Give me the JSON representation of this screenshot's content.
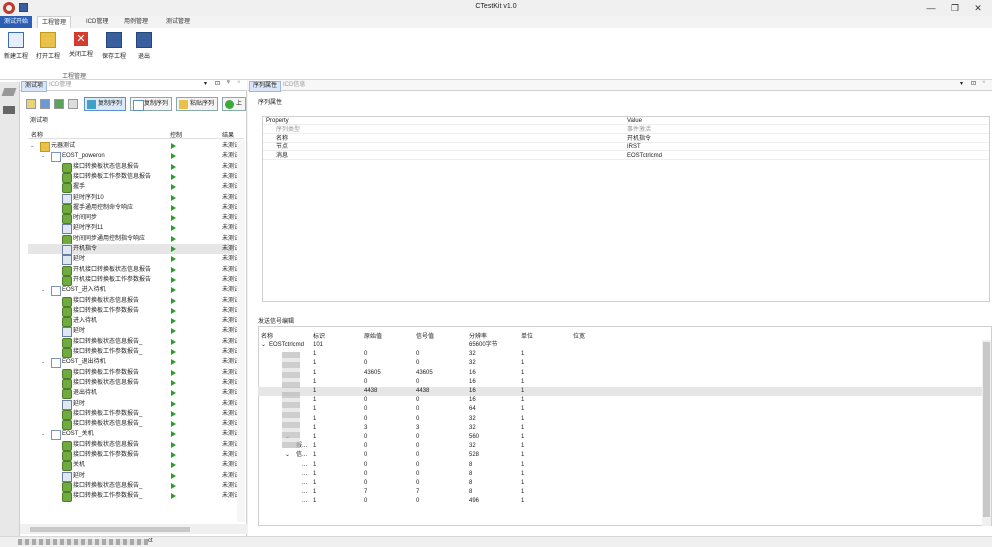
{
  "app": {
    "title": "CTestKit v1.0",
    "window_controls": [
      "—",
      "❐",
      "✕"
    ]
  },
  "ribbon": {
    "tabs": [
      "测试开始",
      "工程管理",
      "ICD管理",
      "用例管理",
      "测试管理"
    ],
    "buttons": [
      "新建工程",
      "打开工程",
      "关闭工程",
      "保存工程",
      "退出"
    ],
    "group_label": "工程管理"
  },
  "left_panel": {
    "tabs": [
      "测试项",
      "ICD管理"
    ],
    "toolbar_buttons": [
      "复制序列",
      "复制序列",
      "粘贴序列",
      "上"
    ],
    "caption": "测试项",
    "columns": [
      "名称",
      "控制",
      "结果"
    ],
    "tree": [
      {
        "label": "元器测试",
        "result": "未测试",
        "indent": 0,
        "type": "folder",
        "arrow": "⌄"
      },
      {
        "label": "EOST_poweron",
        "result": "未测试",
        "indent": 1,
        "type": "doc",
        "arrow": "⌄"
      },
      {
        "label": "接口转换板状态信息报告",
        "result": "未测试",
        "indent": 2,
        "type": "gear"
      },
      {
        "label": "接口转换板工作参数信息报告",
        "result": "未测试",
        "indent": 2,
        "type": "gear"
      },
      {
        "label": "握手",
        "result": "未测试",
        "indent": 2,
        "type": "gear"
      },
      {
        "label": "延时序列10",
        "result": "未测试",
        "indent": 2,
        "type": "wait"
      },
      {
        "label": "握手通用控制命令响应",
        "result": "未测试",
        "indent": 2,
        "type": "gear"
      },
      {
        "label": "时间同步",
        "result": "未测试",
        "indent": 2,
        "type": "gear"
      },
      {
        "label": "延时序列11",
        "result": "未测试",
        "indent": 2,
        "type": "wait"
      },
      {
        "label": "时间同步通用控制指令响应",
        "result": "未测试",
        "indent": 2,
        "type": "gear"
      },
      {
        "label": "开机指令",
        "result": "未测试",
        "indent": 2,
        "type": "wait",
        "selected": true
      },
      {
        "label": "延时",
        "result": "未测试",
        "indent": 2,
        "type": "wait"
      },
      {
        "label": "开机接口转换板状态信息报告",
        "result": "未测试",
        "indent": 2,
        "type": "gear"
      },
      {
        "label": "开机接口转换板工作参数报告",
        "result": "未测试",
        "indent": 2,
        "type": "gear"
      },
      {
        "label": "EOST_进入待机",
        "result": "未测试",
        "indent": 1,
        "type": "doc",
        "arrow": "⌄"
      },
      {
        "label": "接口转换板状态信息报告",
        "result": "未测试",
        "indent": 2,
        "type": "gear"
      },
      {
        "label": "接口转换板工作参数报告",
        "result": "未测试",
        "indent": 2,
        "type": "gear"
      },
      {
        "label": "进入待机",
        "result": "未测试",
        "indent": 2,
        "type": "gear"
      },
      {
        "label": "延时",
        "result": "未测试",
        "indent": 2,
        "type": "wait"
      },
      {
        "label": "接口转换板状态信息报告_",
        "result": "未测试",
        "indent": 2,
        "type": "gear"
      },
      {
        "label": "接口转换板工作参数报告_",
        "result": "未测试",
        "indent": 2,
        "type": "gear"
      },
      {
        "label": "EOST_退出待机",
        "result": "未测试",
        "indent": 1,
        "type": "doc",
        "arrow": "⌄"
      },
      {
        "label": "接口转换板工作参数报告",
        "result": "未测试",
        "indent": 2,
        "type": "gear"
      },
      {
        "label": "接口转换板状态信息报告",
        "result": "未测试",
        "indent": 2,
        "type": "gear"
      },
      {
        "label": "退出待机",
        "result": "未测试",
        "indent": 2,
        "type": "gear"
      },
      {
        "label": "延时",
        "result": "未测试",
        "indent": 2,
        "type": "wait"
      },
      {
        "label": "接口转换板工作参数报告_",
        "result": "未测试",
        "indent": 2,
        "type": "gear"
      },
      {
        "label": "接口转换板状态信息报告_",
        "result": "未测试",
        "indent": 2,
        "type": "gear"
      },
      {
        "label": "EOST_关机",
        "result": "未测试",
        "indent": 1,
        "type": "doc",
        "arrow": "⌄"
      },
      {
        "label": "接口转换板状态信息报告",
        "result": "未测试",
        "indent": 2,
        "type": "gear"
      },
      {
        "label": "接口转换板工作参数报告",
        "result": "未测试",
        "indent": 2,
        "type": "gear"
      },
      {
        "label": "关机",
        "result": "未测试",
        "indent": 2,
        "type": "gear"
      },
      {
        "label": "延时",
        "result": "未测试",
        "indent": 2,
        "type": "wait"
      },
      {
        "label": "接口转换板状态信息报告_",
        "result": "未测试",
        "indent": 2,
        "type": "gear"
      },
      {
        "label": "接口转换板工作参数报告_",
        "result": "未测试",
        "indent": 2,
        "type": "gear"
      }
    ]
  },
  "right_panel": {
    "tabs": [
      "序列属性",
      "ICD信息"
    ],
    "head_icons": [
      "▾",
      "⊡",
      "×"
    ],
    "prop_title": "序列属性",
    "prop_columns": [
      "Property",
      "Value"
    ],
    "prop_rows": [
      {
        "k": "序列类型",
        "v": "事件激活",
        "dim": true
      },
      {
        "k": "名称",
        "v": "开机指令"
      },
      {
        "k": "节点",
        "v": "IRST"
      },
      {
        "k": "消息",
        "v": "EOSTctrlcmd"
      }
    ],
    "sig_title": "发送信号编辑",
    "sig_columns": [
      "名称",
      "标识",
      "原始值",
      "信号值",
      "分辨率",
      "单位",
      "位宽"
    ],
    "sig_rows": [
      {
        "name": "EOSTctrlcmd",
        "id": "101",
        "raw": "",
        "val": "",
        "res": "65600字节",
        "unit": "",
        "arrow": "⌄"
      },
      {
        "name": "",
        "id": "1",
        "raw": "0",
        "val": "0",
        "res": "32",
        "unit": "1"
      },
      {
        "name": "",
        "id": "1",
        "raw": "0",
        "val": "0",
        "res": "32",
        "unit": "1"
      },
      {
        "name": "",
        "id": "1",
        "raw": "43605",
        "val": "43605",
        "res": "16",
        "unit": "1"
      },
      {
        "name": "",
        "id": "1",
        "raw": "0",
        "val": "0",
        "res": "16",
        "unit": "1"
      },
      {
        "name": "",
        "id": "1",
        "raw": "4438",
        "val": "4438",
        "res": "16",
        "unit": "1",
        "selected": true
      },
      {
        "name": "",
        "id": "1",
        "raw": "0",
        "val": "0",
        "res": "16",
        "unit": "1"
      },
      {
        "name": "",
        "id": "1",
        "raw": "0",
        "val": "0",
        "res": "64",
        "unit": "1"
      },
      {
        "name": "",
        "id": "1",
        "raw": "0",
        "val": "0",
        "res": "32",
        "unit": "1"
      },
      {
        "name": "",
        "id": "1",
        "raw": "3",
        "val": "3",
        "res": "32",
        "unit": "1"
      },
      {
        "name": "",
        "id": "1",
        "raw": "0",
        "val": "0",
        "res": "560",
        "unit": "1",
        "arrow": "⌄"
      },
      {
        "name": "报...",
        "id": "1",
        "raw": "0",
        "val": "0",
        "res": "32",
        "unit": "1"
      },
      {
        "name": "信...",
        "id": "1",
        "raw": "0",
        "val": "0",
        "res": "528",
        "unit": "1",
        "arrow": "⌄"
      },
      {
        "name": "...",
        "id": "1",
        "raw": "0",
        "val": "0",
        "res": "8",
        "unit": "1"
      },
      {
        "name": "...",
        "id": "1",
        "raw": "0",
        "val": "0",
        "res": "8",
        "unit": "1"
      },
      {
        "name": "...",
        "id": "1",
        "raw": "0",
        "val": "0",
        "res": "8",
        "unit": "1"
      },
      {
        "name": "...",
        "id": "1",
        "raw": "7",
        "val": "7",
        "res": "8",
        "unit": "1"
      },
      {
        "name": "...",
        "id": "1",
        "raw": "0",
        "val": "0",
        "res": "496",
        "unit": "1"
      }
    ]
  },
  "statusbar": {
    "text": "ct"
  }
}
